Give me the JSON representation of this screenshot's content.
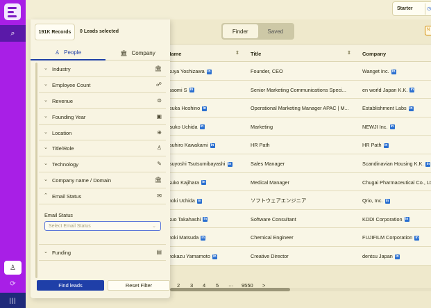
{
  "topbar": {
    "plan": "Starter",
    "plan_icon": "⊙"
  },
  "rail": {
    "search_icon": "⌕",
    "user_icon": "♙",
    "logout_icon": "⟳",
    "bottom_icon": "|||"
  },
  "panel": {
    "records": "191K Records",
    "leads_selected": "0 Leads selected",
    "tabs": {
      "people": "People",
      "company": "Company"
    },
    "filters": [
      {
        "label": "Industry",
        "icon": "🏛"
      },
      {
        "label": "Employee Count",
        "icon": "☍"
      },
      {
        "label": "Revenue",
        "icon": "⊜"
      },
      {
        "label": "Founding Year",
        "icon": "▣"
      },
      {
        "label": "Location",
        "icon": "⊕"
      },
      {
        "label": "Title/Role",
        "icon": "♙"
      },
      {
        "label": "Technology",
        "icon": "✎"
      },
      {
        "label": "Company name / Domain",
        "icon": "🏛"
      },
      {
        "label": "Email Status",
        "icon": "✉"
      }
    ],
    "email_status": {
      "label": "Email Status",
      "placeholder": "Select Email Status"
    },
    "funding": {
      "label": "Funding",
      "icon": "▤"
    },
    "find_leads": "Find leads",
    "reset_filter": "Reset Filter"
  },
  "main": {
    "toggle": {
      "finder": "Finder",
      "saved": "Saved"
    },
    "corner_button": "N",
    "columns": {
      "name": "Name",
      "title": "Title",
      "company": "Company"
    },
    "rows": [
      {
        "name": "Tatsuya Yoshizawa",
        "title": "Founder, CEO",
        "company": "Wanget Inc."
      },
      {
        "name": "Masaomi S",
        "title": "Senior Marketing Communications Speci...",
        "company": "en world Japan K.K."
      },
      {
        "name": "Katsuka Hoshino",
        "title": "Operational Marketing Manager APAC | M...",
        "company": "Establishment Labs"
      },
      {
        "name": "Natsuko Uchida",
        "title": "Marketing",
        "company": "NEWJI Inc."
      },
      {
        "name": "Katsuhiro Kawakami",
        "title": "HR Path",
        "company": "HR Path"
      },
      {
        "name": "Katsuyoshi Tsutsumibayashi",
        "title": "Sales Manager",
        "company": "Scandinavian Housing K.K."
      },
      {
        "name": "Mitsuko Kajihara",
        "title": "Medical Manager",
        "company": "Chugai Pharmaceutical Co., Lt"
      },
      {
        "name": "Tomoki Uchida",
        "title": "ソフトウェアエンジニア",
        "company": "Qrio, Inc."
      },
      {
        "name": "Tetsuo Takahashi",
        "title": "Software Consultant",
        "company": "KDDI Corporation"
      },
      {
        "name": "Tomoki Matsuda",
        "title": "Chemical Engineer",
        "company": "FUJIFILM Corporation"
      },
      {
        "name": "Tomokazu Yamamoto",
        "title": "Creative Director",
        "company": "dentsu Japan"
      }
    ],
    "pages": [
      "2",
      "3",
      "4",
      "5",
      "···",
      "9550",
      ">"
    ]
  }
}
